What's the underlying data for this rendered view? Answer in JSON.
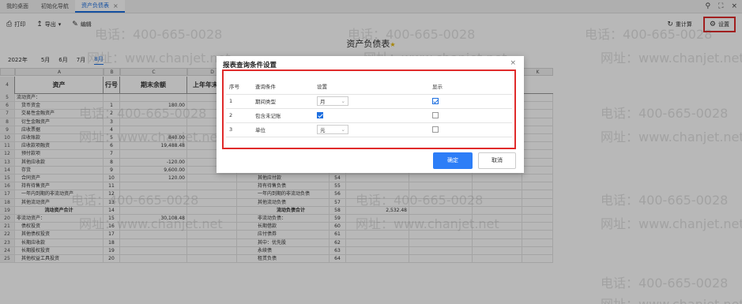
{
  "tabs": [
    {
      "label": "我的桌面",
      "active": false,
      "closable": false
    },
    {
      "label": "初始化导航",
      "active": false,
      "closable": false
    },
    {
      "label": "资产负债表",
      "active": true,
      "closable": true
    }
  ],
  "toolbar": {
    "print": "打印",
    "export": "导出",
    "edit": "编辑",
    "recalc": "重计算",
    "settings": "设置"
  },
  "sheet_title": "资产负债表",
  "periods": {
    "year": "2022年",
    "months": [
      "5月",
      "6月",
      "7月",
      "8月"
    ],
    "current": "8月"
  },
  "grid": {
    "col_letters": [
      "A",
      "B",
      "C",
      "D",
      "E",
      "F",
      "G",
      "H",
      "I",
      "J",
      "K"
    ],
    "header": [
      "资产",
      "行号",
      "期末余额",
      "上年年末余额"
    ],
    "left_rows": [
      {
        "rn": "5",
        "name": "流动资产：",
        "no": "",
        "val": ""
      },
      {
        "rn": "6",
        "name": "货币资金",
        "no": "1",
        "val": "180.00"
      },
      {
        "rn": "7",
        "name": "交易性金融资产",
        "no": "2",
        "val": ""
      },
      {
        "rn": "8",
        "name": "衍生金融资产",
        "no": "3",
        "val": ""
      },
      {
        "rn": "9",
        "name": "应收票据",
        "no": "4",
        "val": ""
      },
      {
        "rn": "10",
        "name": "应收账款",
        "no": "5",
        "val": "840.00"
      },
      {
        "rn": "11",
        "name": "应收款项融资",
        "no": "6",
        "val": "19,488.48"
      },
      {
        "rn": "12",
        "name": "预付款项",
        "no": "7",
        "val": ""
      },
      {
        "rn": "13",
        "name": "其他应收款",
        "no": "8",
        "val": "-120.00"
      },
      {
        "rn": "14",
        "name": "存货",
        "no": "9",
        "val": "9,600.00"
      },
      {
        "rn": "15",
        "name": "合同资产",
        "no": "10",
        "val": "120.00"
      },
      {
        "rn": "16",
        "name": "持有待售资产",
        "no": "11",
        "val": ""
      },
      {
        "rn": "17",
        "name": "一年内到期的非流动资产",
        "no": "12",
        "val": ""
      },
      {
        "rn": "18",
        "name": "其他流动资产",
        "no": "13",
        "val": ""
      },
      {
        "rn": "19",
        "name": "流动资产合计",
        "no": "14",
        "val": ""
      },
      {
        "rn": "20",
        "name": "非流动资产：",
        "no": "15",
        "val": "30,108.48"
      },
      {
        "rn": "21",
        "name": "债权投资",
        "no": "16",
        "val": ""
      },
      {
        "rn": "22",
        "name": "其他债权投资",
        "no": "17",
        "val": ""
      },
      {
        "rn": "23",
        "name": "长期应收款",
        "no": "18",
        "val": ""
      },
      {
        "rn": "24",
        "name": "长期股权投资",
        "no": "19",
        "val": ""
      },
      {
        "rn": "25",
        "name": "其他权益工具投资",
        "no": "20",
        "val": ""
      }
    ],
    "right_rows": [
      {
        "name": "应付职工薪酬",
        "no": "52",
        "val": ""
      },
      {
        "name": "应交税费",
        "no": "53",
        "val": "2,352.48"
      },
      {
        "name": "其他应付款",
        "no": "54",
        "val": ""
      },
      {
        "name": "持有待售负债",
        "no": "55",
        "val": ""
      },
      {
        "name": "一年内到期的非流动负债",
        "no": "56",
        "val": ""
      },
      {
        "name": "其他流动负债",
        "no": "57",
        "val": ""
      },
      {
        "name": "流动负债合计",
        "no": "58",
        "val": "2,532.48"
      },
      {
        "name": "非流动负债：",
        "no": "59",
        "val": ""
      },
      {
        "name": "长期借款",
        "no": "60",
        "val": ""
      },
      {
        "name": "应付债券",
        "no": "61",
        "val": ""
      },
      {
        "name": "其中：优先股",
        "no": "62",
        "val": ""
      },
      {
        "name": "永续债",
        "no": "63",
        "val": ""
      },
      {
        "name": "租赁负债",
        "no": "64",
        "val": ""
      }
    ]
  },
  "watermark": {
    "phone": "电话：400-665-0028",
    "site": "网址：www.chanjet.net"
  },
  "dialog": {
    "title": "报表查询条件设置",
    "columns": [
      "序号",
      "查询条件",
      "设置",
      "显示"
    ],
    "rows": [
      {
        "no": "1",
        "condition": "期间类型",
        "setting_type": "select",
        "setting_value": "月",
        "display": "checked-outline"
      },
      {
        "no": "2",
        "condition": "包含未记账",
        "setting_type": "checkbox",
        "setting_value": "checked",
        "display": "unchecked"
      },
      {
        "no": "3",
        "condition": "单位",
        "setting_type": "select",
        "setting_value": "元",
        "display": "unchecked"
      }
    ],
    "ok": "确定",
    "cancel": "取消"
  }
}
